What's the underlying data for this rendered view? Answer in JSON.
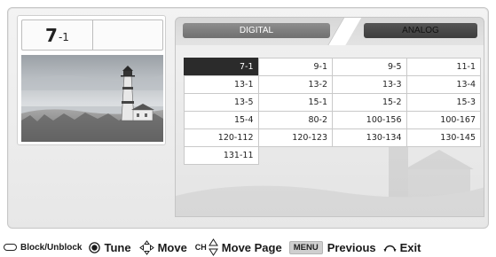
{
  "channel_banner": {
    "major": "7",
    "minor": "-1"
  },
  "tabs": [
    {
      "label": "DIGITAL",
      "active": true
    },
    {
      "label": "ANALOG",
      "active": false
    }
  ],
  "channels": [
    "7-1",
    "9-1",
    "9-5",
    "11-1",
    "13-1",
    "13-2",
    "13-3",
    "13-4",
    "13-5",
    "15-1",
    "15-2",
    "15-3",
    "15-4",
    "80-2",
    "100-156",
    "100-167",
    "120-112",
    "120-123",
    "130-134",
    "130-145",
    "131-11"
  ],
  "selected_channel": "7-1",
  "legend": {
    "block_unblock": "Block/Unblock",
    "tune": "Tune",
    "move": "Move",
    "ch": "CH",
    "move_page": "Move Page",
    "menu": "MENU",
    "previous": "Previous",
    "exit": "Exit"
  },
  "colors": {
    "selected_cell": "#2b2b2b",
    "digital_tab": "#7a7a7a",
    "analog_tab": "#444444"
  }
}
